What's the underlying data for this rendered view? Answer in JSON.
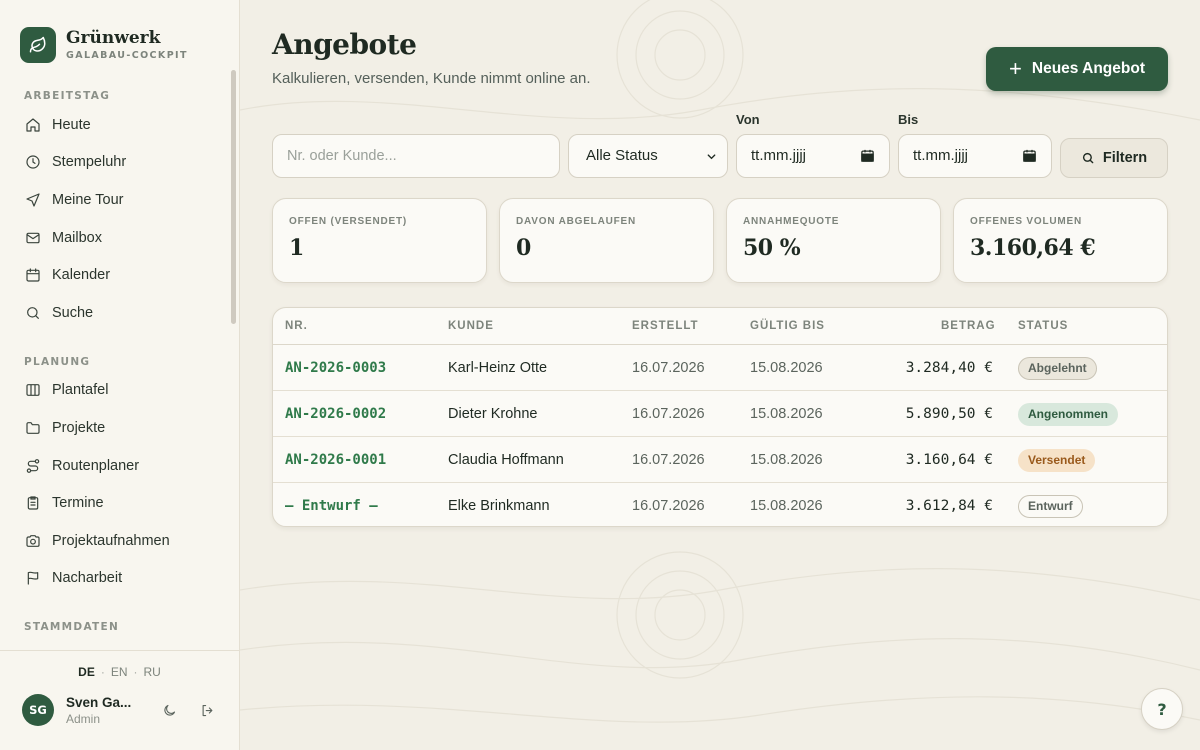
{
  "brand": {
    "name": "Grünwerk",
    "subtitle": "GALABAU-COCKPIT"
  },
  "sidebar": {
    "sections": [
      {
        "title": "ARBEITSTAG",
        "items": [
          {
            "label": "Heute",
            "icon": "home-icon"
          },
          {
            "label": "Stempeluhr",
            "icon": "clock-icon"
          },
          {
            "label": "Meine Tour",
            "icon": "navigation-icon"
          },
          {
            "label": "Mailbox",
            "icon": "mail-icon"
          },
          {
            "label": "Kalender",
            "icon": "calendar-icon"
          },
          {
            "label": "Suche",
            "icon": "search-icon"
          }
        ]
      },
      {
        "title": "PLANUNG",
        "items": [
          {
            "label": "Plantafel",
            "icon": "board-icon"
          },
          {
            "label": "Projekte",
            "icon": "folder-icon"
          },
          {
            "label": "Routenplaner",
            "icon": "route-icon"
          },
          {
            "label": "Termine",
            "icon": "clipboard-icon"
          },
          {
            "label": "Projektaufnahmen",
            "icon": "camera-icon"
          },
          {
            "label": "Nacharbeit",
            "icon": "flag-icon"
          }
        ]
      },
      {
        "title": "STAMMDATEN",
        "items": []
      }
    ]
  },
  "languages": {
    "options": [
      "DE",
      "EN",
      "RU"
    ],
    "active": "DE"
  },
  "user": {
    "initials": "SG",
    "name": "Sven Ga...",
    "role": "Admin"
  },
  "page": {
    "title": "Angebote",
    "subtitle": "Kalkulieren, versenden, Kunde nimmt online an.",
    "new_button": "Neues Angebot"
  },
  "filters": {
    "search_placeholder": "Nr. oder Kunde...",
    "status_value": "Alle Status",
    "from_label": "Von",
    "to_label": "Bis",
    "date_placeholder": "tt.mm.jjjj",
    "filter_button": "Filtern"
  },
  "stats": [
    {
      "label": "OFFEN (VERSENDET)",
      "value": "1"
    },
    {
      "label": "DAVON ABGELAUFEN",
      "value": "0"
    },
    {
      "label": "ANNAHMEQUOTE",
      "value": "50 %"
    },
    {
      "label": "OFFENES VOLUMEN",
      "value": "3.160,64 €"
    }
  ],
  "table": {
    "headers": [
      "NR.",
      "KUNDE",
      "ERSTELLT",
      "GÜLTIG BIS",
      "BETRAG",
      "STATUS"
    ],
    "rows": [
      {
        "nr": "AN-2026-0003",
        "kunde": "Karl-Heinz Otte",
        "erstellt": "16.07.2026",
        "gueltig": "15.08.2026",
        "betrag": "3.284,40 €",
        "status": "Abgelehnt"
      },
      {
        "nr": "AN-2026-0002",
        "kunde": "Dieter Krohne",
        "erstellt": "16.07.2026",
        "gueltig": "15.08.2026",
        "betrag": "5.890,50 €",
        "status": "Angenommen"
      },
      {
        "nr": "AN-2026-0001",
        "kunde": "Claudia Hoffmann",
        "erstellt": "16.07.2026",
        "gueltig": "15.08.2026",
        "betrag": "3.160,64 €",
        "status": "Versendet"
      },
      {
        "nr": "— Entwurf —",
        "kunde": "Elke Brinkmann",
        "erstellt": "16.07.2026",
        "gueltig": "15.08.2026",
        "betrag": "3.612,84 €",
        "status": "Entwurf"
      }
    ]
  },
  "status_colors": {
    "Abgelehnt": {
      "bg": "#ebe7dc",
      "fg": "#5b645d",
      "border": "#c9c4b6"
    },
    "Angenommen": {
      "bg": "#d8e8dc",
      "fg": "#2f5b40",
      "border": "#d8e8dc"
    },
    "Versendet": {
      "bg": "#f6e2c8",
      "fg": "#9a5a1c",
      "border": "#f6e2c8"
    },
    "Entwurf": {
      "bg": "#fbfaf6",
      "fg": "#5b645d",
      "border": "#c9c4b6"
    }
  },
  "help": {
    "label": "?"
  },
  "colors": {
    "accent": "#2f5b40",
    "link": "#2f7a4a",
    "background": "#f2efe6"
  }
}
